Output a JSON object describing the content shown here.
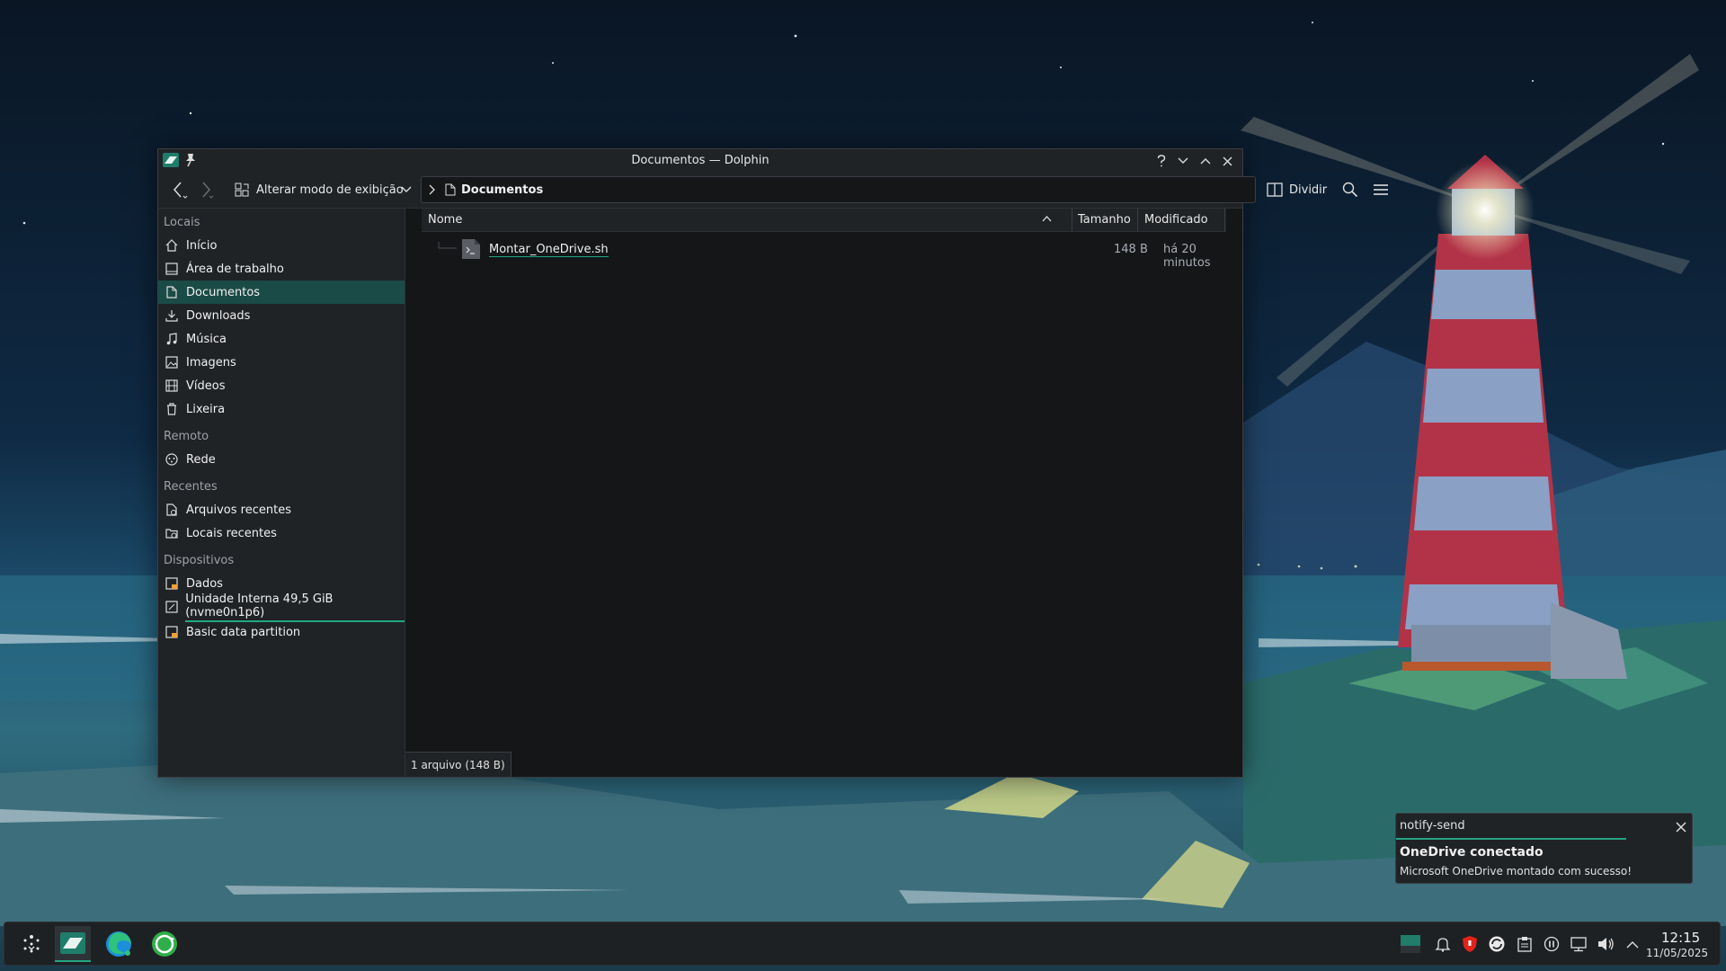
{
  "window": {
    "title": "Documentos — Dolphin"
  },
  "toolbar": {
    "view_mode_label": "Alterar modo de exibição",
    "breadcrumb_current": "Documentos",
    "split_label": "Dividir"
  },
  "sidebar": {
    "sections": [
      {
        "title": "Locais",
        "items": [
          {
            "label": "Início",
            "icon": "home-icon"
          },
          {
            "label": "Área de trabalho",
            "icon": "desktop-icon"
          },
          {
            "label": "Documentos",
            "icon": "documents-icon",
            "active": true
          },
          {
            "label": "Downloads",
            "icon": "download-icon"
          },
          {
            "label": "Música",
            "icon": "music-icon"
          },
          {
            "label": "Imagens",
            "icon": "image-icon"
          },
          {
            "label": "Vídeos",
            "icon": "video-icon"
          },
          {
            "label": "Lixeira",
            "icon": "trash-icon"
          }
        ]
      },
      {
        "title": "Remoto",
        "items": [
          {
            "label": "Rede",
            "icon": "network-icon"
          }
        ]
      },
      {
        "title": "Recentes",
        "items": [
          {
            "label": "Arquivos recentes",
            "icon": "recent-files-icon"
          },
          {
            "label": "Locais recentes",
            "icon": "recent-places-icon"
          }
        ]
      },
      {
        "title": "Dispositivos",
        "items": [
          {
            "label": "Dados",
            "icon": "drive-icon"
          },
          {
            "label": "Unidade Interna 49,5 GiB (nvme0n1p6)",
            "icon": "drive-icon",
            "mounted": true
          },
          {
            "label": "Basic data partition",
            "icon": "drive-icon"
          }
        ]
      }
    ]
  },
  "file_list": {
    "columns": [
      "Nome",
      "Tamanho",
      "Modificado"
    ],
    "rows": [
      {
        "name": "Montar_OneDrive.sh",
        "size": "148 B",
        "modified": "há 20 minutos",
        "icon": "script-file-icon"
      }
    ]
  },
  "statusbar": {
    "text": "1 arquivo (148 B)"
  },
  "notification": {
    "app": "notify-send",
    "title": "OneDrive conectado",
    "body": "Microsoft OneDrive montado com sucesso!"
  },
  "taskbar": {
    "time": "12:15",
    "date": "11/05/2025",
    "apps": [
      "application-launcher-icon",
      "dolphin-icon",
      "edge-browser-icon",
      "update-manager-icon"
    ],
    "tray": [
      "onedrive-tray-icon",
      "bell-icon",
      "shield-icon",
      "sync-icon",
      "clipboard-icon",
      "pause-icon",
      "network-icon",
      "volume-icon",
      "chevron-up-icon"
    ]
  },
  "colors": {
    "accent": "#22a683",
    "selection": "#1b4b46",
    "window_bg": "#141618",
    "panel_bg": "#202326"
  }
}
